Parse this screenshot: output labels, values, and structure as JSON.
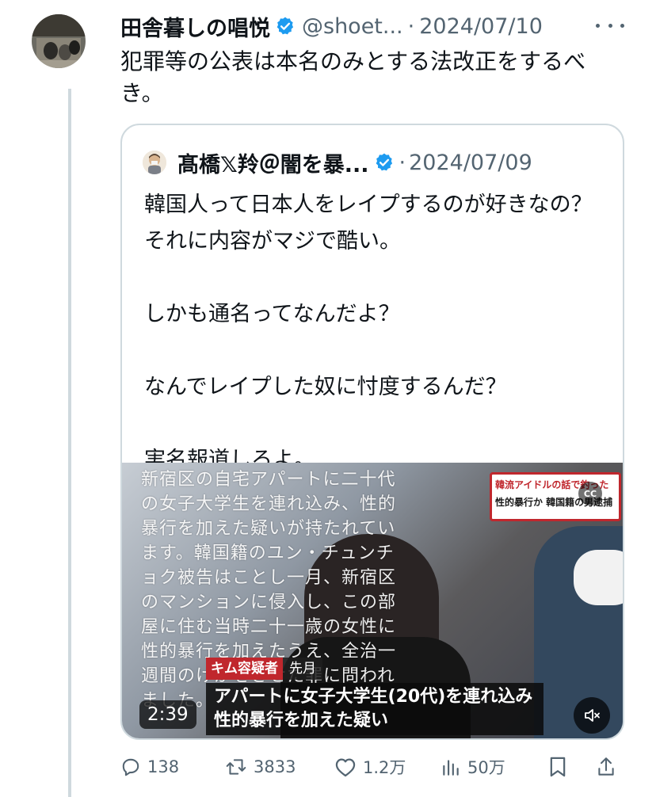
{
  "tweet": {
    "author_name": "田舎暮しの唱悦",
    "handle": "@shoet...",
    "separator": "·",
    "date": "2024/07/10",
    "text": "犯罪等の公表は本名のみとする法改正をするべき。"
  },
  "quote": {
    "author_name": "髙橋𝕏羚＠闇を暴...",
    "separator": "·",
    "date": "2024/07/09",
    "paragraphs": [
      "韓国人って日本人をレイプするのが好きなの？それに内容がマジで酷い。",
      "しかも通名ってなんだよ？",
      "なんでレイプした奴に忖度するんだ？",
      "実名報道しろよ。"
    ],
    "video": {
      "caption_overlay": "新宿区の自宅アパートに二十代の女子大学生を連れ込み、性的暴行を加えた疑いが持たれています。韓国籍のユン・チュンチョク被告はことし一月、新宿区のマンションに侵入し、この部屋に住む当時二十一歳の女性に性的暴行を加えたうえ、全治一週間のけがをさせた罪に問われました。",
      "news_box_top": "韓流アイドルの話で釣った",
      "news_box_bottom": "性的暴行か 韓国籍の男逮捕",
      "cc_label": "CC",
      "name_tag": "キム容疑者",
      "name_tag_extra": "先月",
      "lower_third_line1": "アパートに女子大学生(20代)を連れ込み",
      "lower_third_line2": "性的暴行を加えた疑い",
      "duration": "2:39"
    }
  },
  "actions": {
    "replies": "138",
    "reposts": "3833",
    "likes": "1.2万",
    "views": "50万"
  },
  "colors": {
    "verified_blue": "#1d9bf0",
    "secondary_text": "#536471",
    "border": "#cfd9de",
    "news_red": "#c0272d"
  }
}
